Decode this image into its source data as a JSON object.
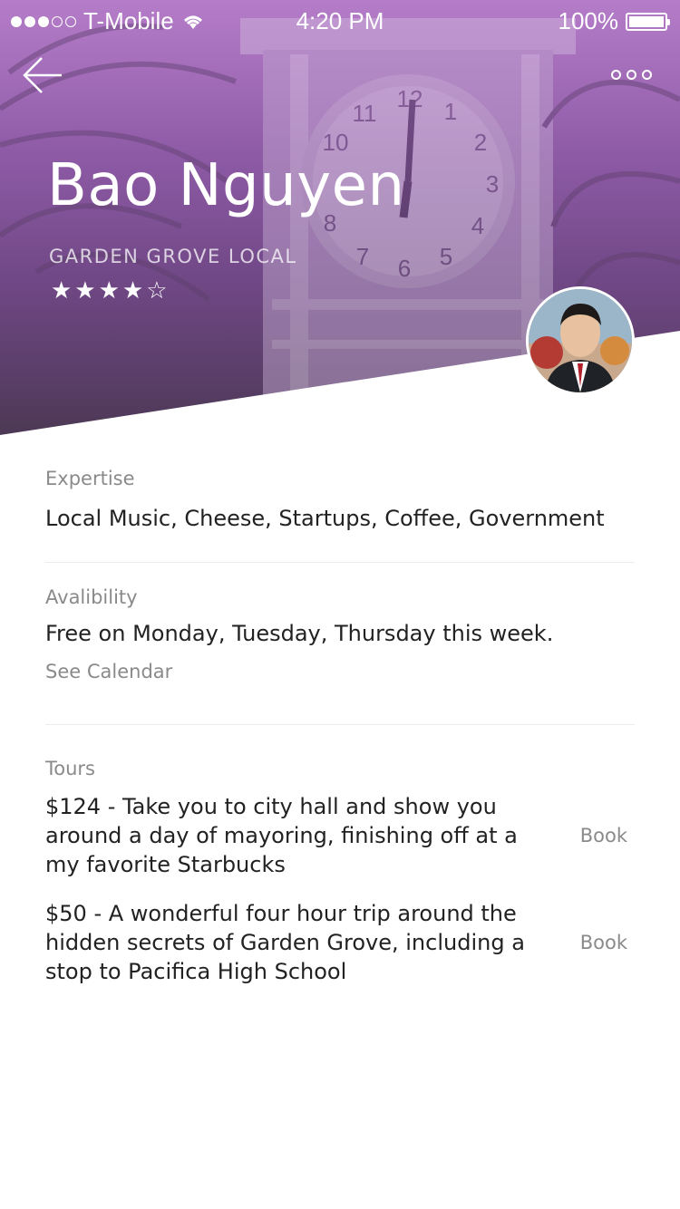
{
  "status_bar": {
    "carrier": "T-Mobile",
    "time": "4:20 PM",
    "battery": "100%",
    "signal_bars_filled": 3,
    "signal_bars_total": 5
  },
  "header": {
    "name": "Bao Nguyen",
    "subtitle": "GARDEN GROVE LOCAL",
    "rating": 4,
    "rating_max": 5,
    "stars": "★★★★☆"
  },
  "icons": {
    "back": "back-arrow-icon",
    "more": "more-options-icon",
    "wifi": "wifi-icon",
    "battery": "battery-icon"
  },
  "colors": {
    "hero_purple": "#9a64b4",
    "text_primary": "#222222",
    "text_secondary": "#8a8a8a",
    "divider": "#ececec"
  },
  "expertise": {
    "label": "Expertise",
    "value": "Local Music, Cheese, Startups, Coffee, Government"
  },
  "availability": {
    "label": "Avalibility",
    "value": "Free on Monday, Tuesday, Thursday this week.",
    "link": "See Calendar"
  },
  "tours": {
    "label": "Tours",
    "items": [
      {
        "text": "$124 - Take you to city hall and show you around a day of mayoring, finishing off at a my favorite Starbucks",
        "action": "Book"
      },
      {
        "text": "$50 -  A wonderful four hour trip around the hidden secrets of Garden Grove, including a stop to Pacifica High School",
        "action": "Book"
      }
    ]
  }
}
